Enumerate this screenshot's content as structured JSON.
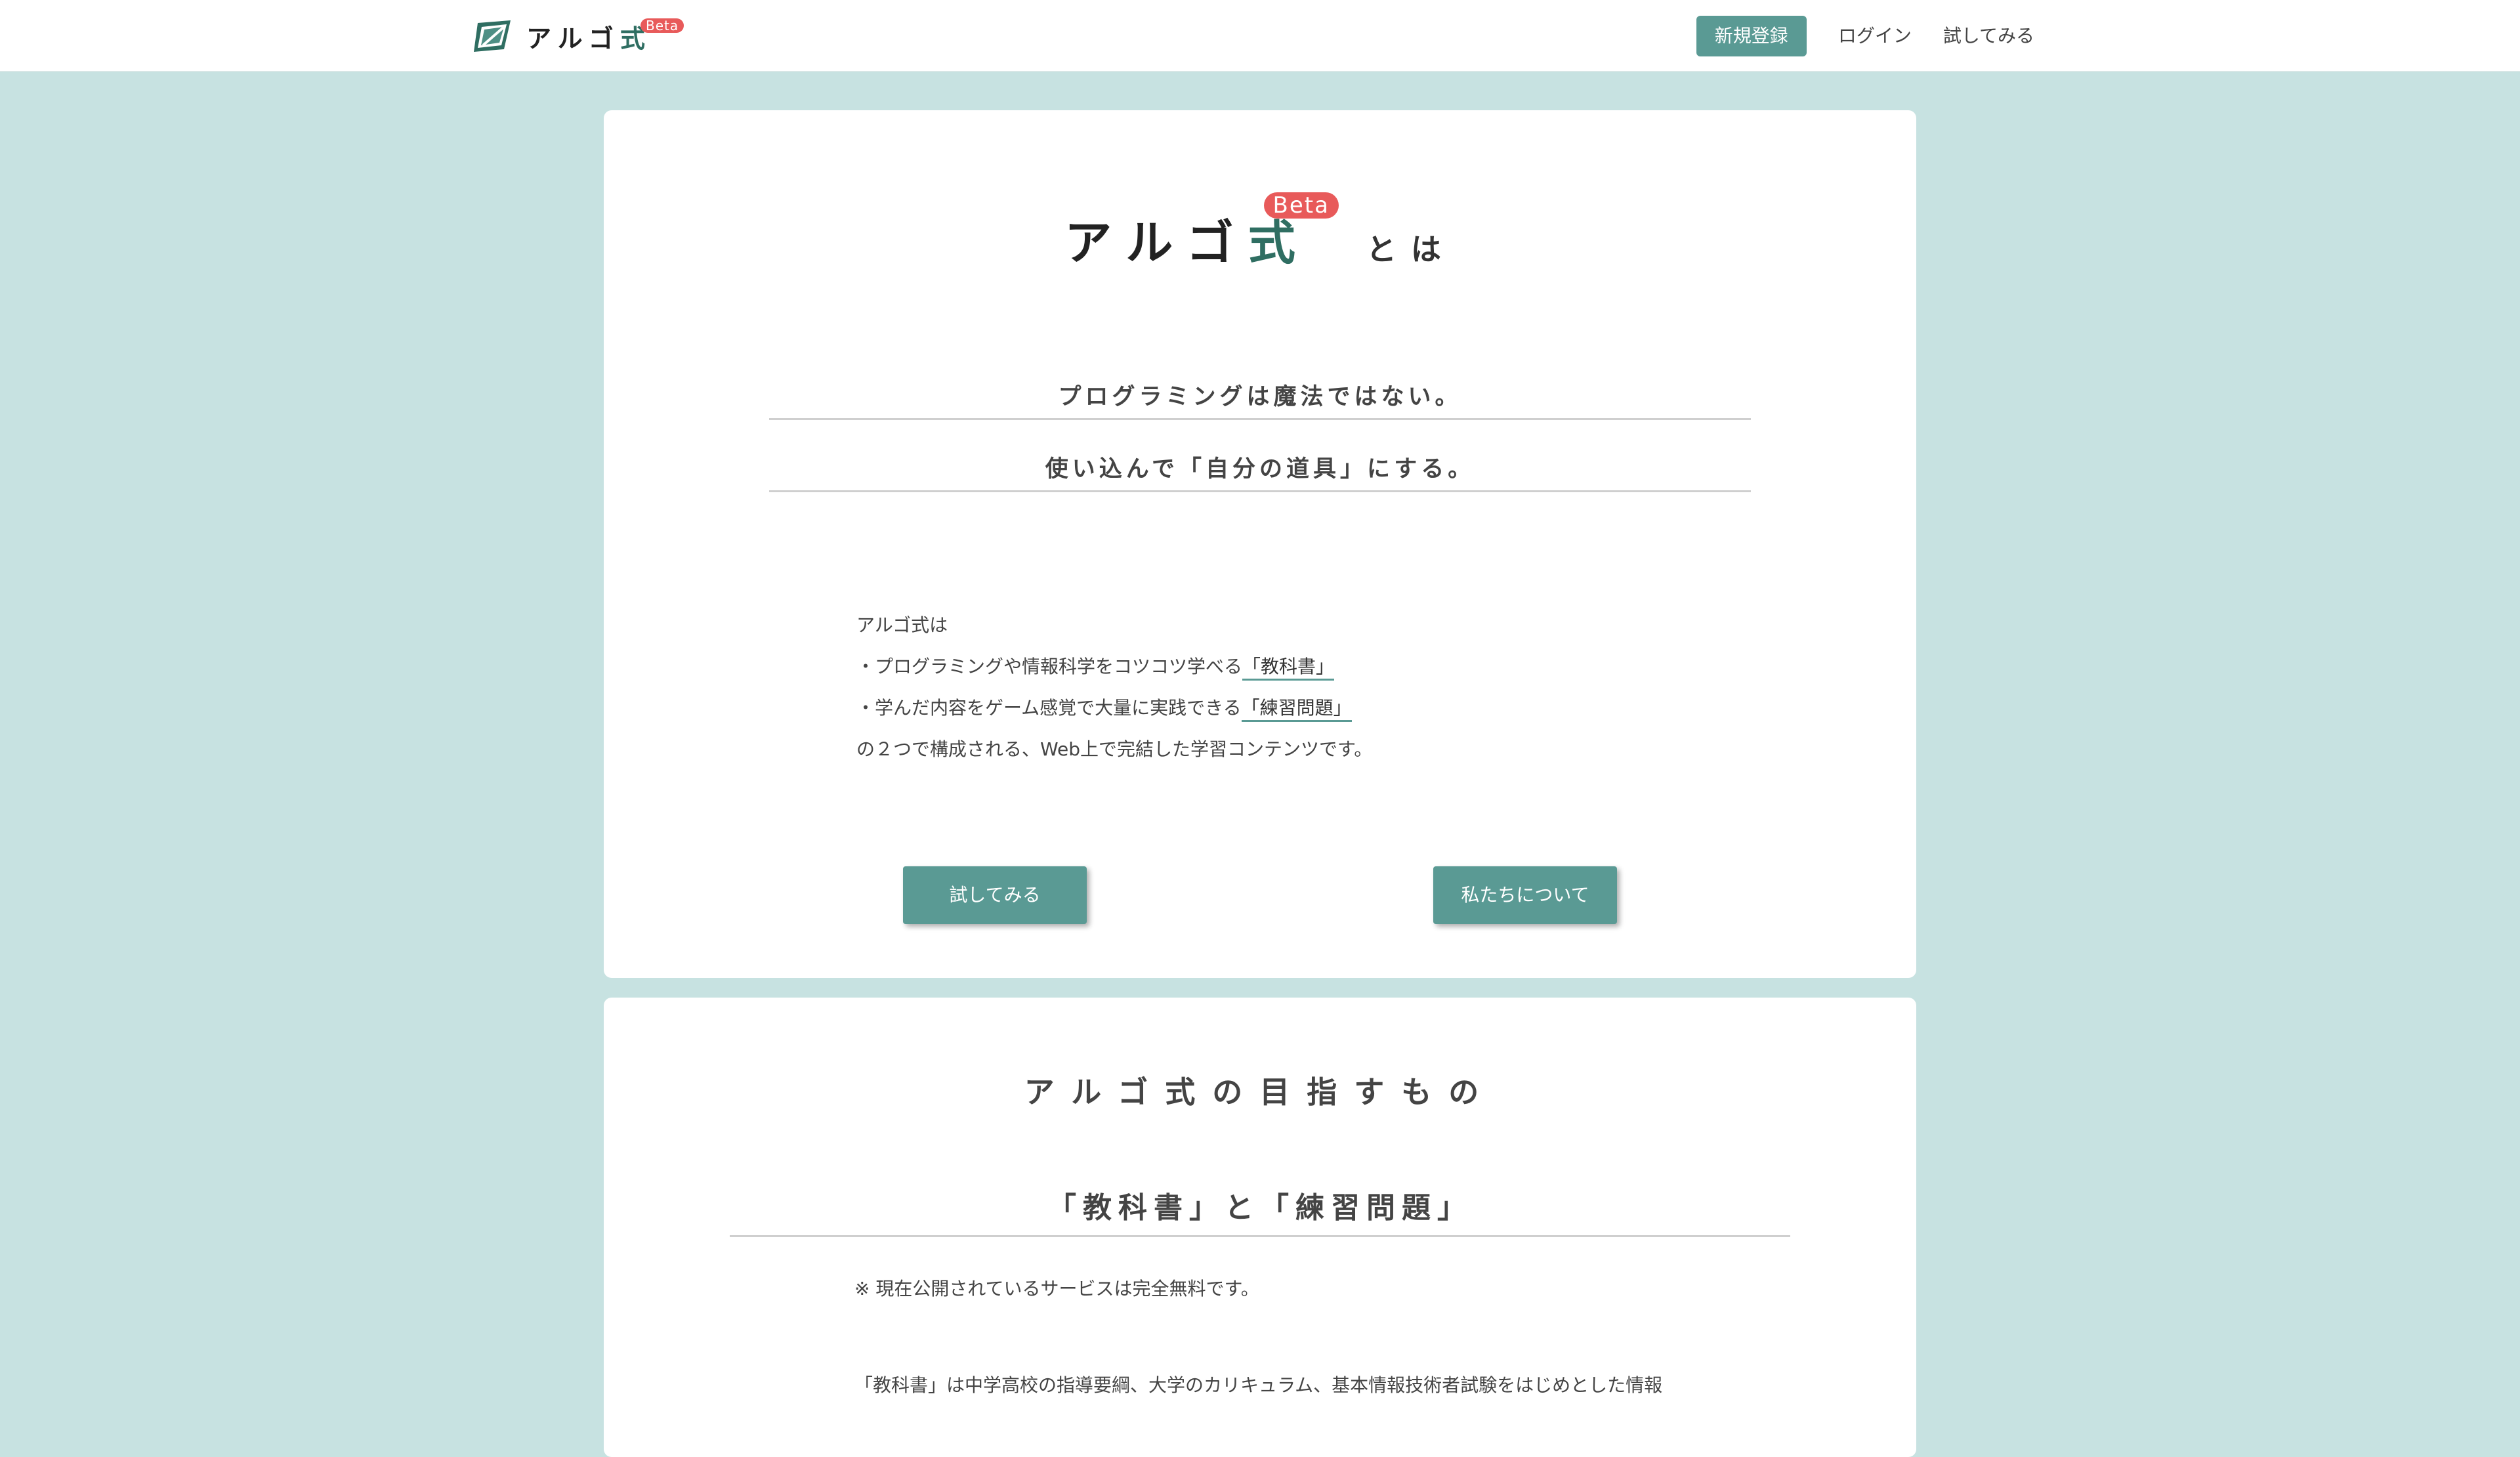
{
  "header": {
    "brand_name": "アルゴ",
    "brand_shiki": "式",
    "brand_beta": "Beta",
    "nav": {
      "signup": "新規登録",
      "login": "ログイン",
      "try": "試してみる"
    }
  },
  "hero": {
    "logo_name": "アルゴ",
    "logo_shiki": "式",
    "beta": "Beta",
    "towa": "とは",
    "tagline1": "プログラミングは魔法ではない。",
    "tagline2": "使い込んで「自分の道具」にする。",
    "intro": {
      "line1": "アルゴ式は",
      "line2_prefix": "・プログラミングや情報科学をコツコツ学べる",
      "line2_highlight": "「教科書」",
      "line3_prefix": "・学んだ内容をゲーム感覚で大量に実践できる",
      "line3_highlight": "「練習問題」",
      "line4": "の２つで構成される、Web上で完結した学習コンテンツです。"
    },
    "buttons": {
      "try": "試してみる",
      "about": "私たちについて"
    }
  },
  "section": {
    "title": "アルゴ式の目指すもの",
    "subtitle": "「教科書」と「練習問題」",
    "note": "※ 現在公開されているサービスは完全無料です。",
    "body": "「教科書」は中学高校の指導要綱、大学のカリキュラム、基本情報技術者試験をはじめとした情報"
  },
  "colors": {
    "background": "#c7e2e1",
    "accent": "#5a9a94",
    "beta_badge": "#e85a5a",
    "logo_green": "#2f6e62"
  },
  "icons": {
    "brand_mark": "algo-shiki-logo-icon"
  }
}
